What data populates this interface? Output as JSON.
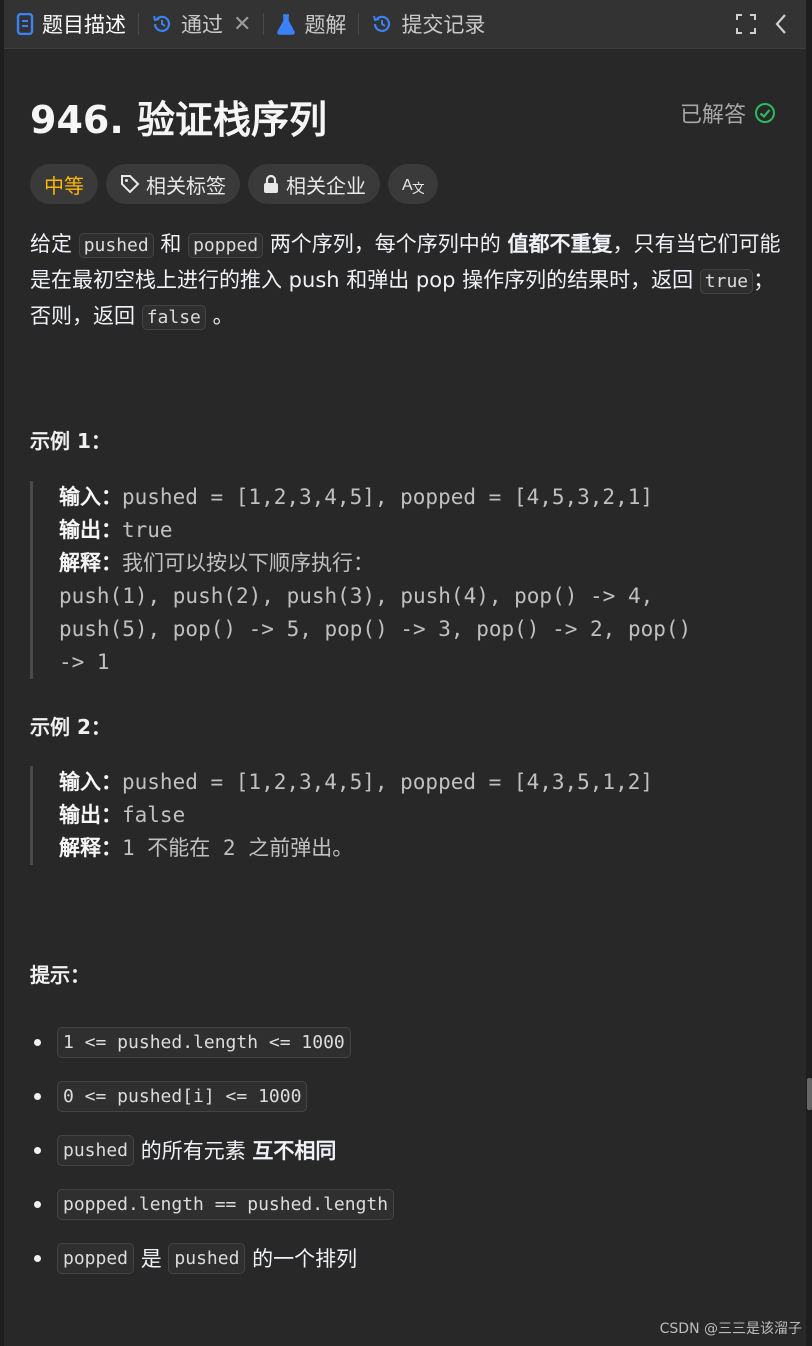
{
  "tabs": {
    "description": "题目描述",
    "passed": "通过",
    "solutions": "题解",
    "submissions": "提交记录"
  },
  "problem": {
    "title": "946. 验证栈序列",
    "status": "已解答",
    "difficulty": "中等",
    "tag_related": "相关标签",
    "tag_companies": "相关企业",
    "desc_1": "给定",
    "code_pushed": "pushed",
    "desc_and": "和",
    "code_popped": "popped",
    "desc_2": "两个序列，每个序列中的",
    "desc_bold": "值都不重复",
    "desc_3": "，只有当它们可能是在最初空栈上进行的推入 push 和弹出 pop 操作序列的结果时，返回",
    "code_true": "true",
    "desc_4": "；否则，返回",
    "code_false": "false",
    "desc_5": "。"
  },
  "examples": {
    "ex1_title": "示例 1：",
    "ex1_in_label": "输入：",
    "ex1_in": "pushed = [1,2,3,4,5], popped = [4,5,3,2,1]",
    "ex1_out_label": "输出：",
    "ex1_out": "true",
    "ex1_exp_label": "解释：",
    "ex1_exp": "我们可以按以下顺序执行：",
    "ex1_line1": "push(1), push(2), push(3), push(4), pop() -> 4,",
    "ex1_line2": "push(5), pop() -> 5, pop() -> 3, pop() -> 2, pop()",
    "ex1_line3": "-> 1",
    "ex2_title": "示例 2：",
    "ex2_in_label": "输入：",
    "ex2_in": "pushed = [1,2,3,4,5], popped = [4,3,5,1,2]",
    "ex2_out_label": "输出：",
    "ex2_out": "false",
    "ex2_exp_label": "解释：",
    "ex2_exp": "1 不能在 2 之前弹出。"
  },
  "hints": {
    "title": "提示：",
    "c1": "1 <= pushed.length <= 1000",
    "c2": "0 <= pushed[i] <= 1000",
    "c3_code": "pushed",
    "c3_text": "的所有元素",
    "c3_bold": "互不相同",
    "c4": "popped.length == pushed.length",
    "c5_code1": "popped",
    "c5_text1": "是",
    "c5_code2": "pushed",
    "c5_text2": "的一个排列"
  },
  "watermark": "CSDN @三三是该溜子",
  "colors": {
    "difficulty": "#ffb800",
    "solved_check": "#2cbb5d",
    "accent_blue": "#3b82f6"
  }
}
